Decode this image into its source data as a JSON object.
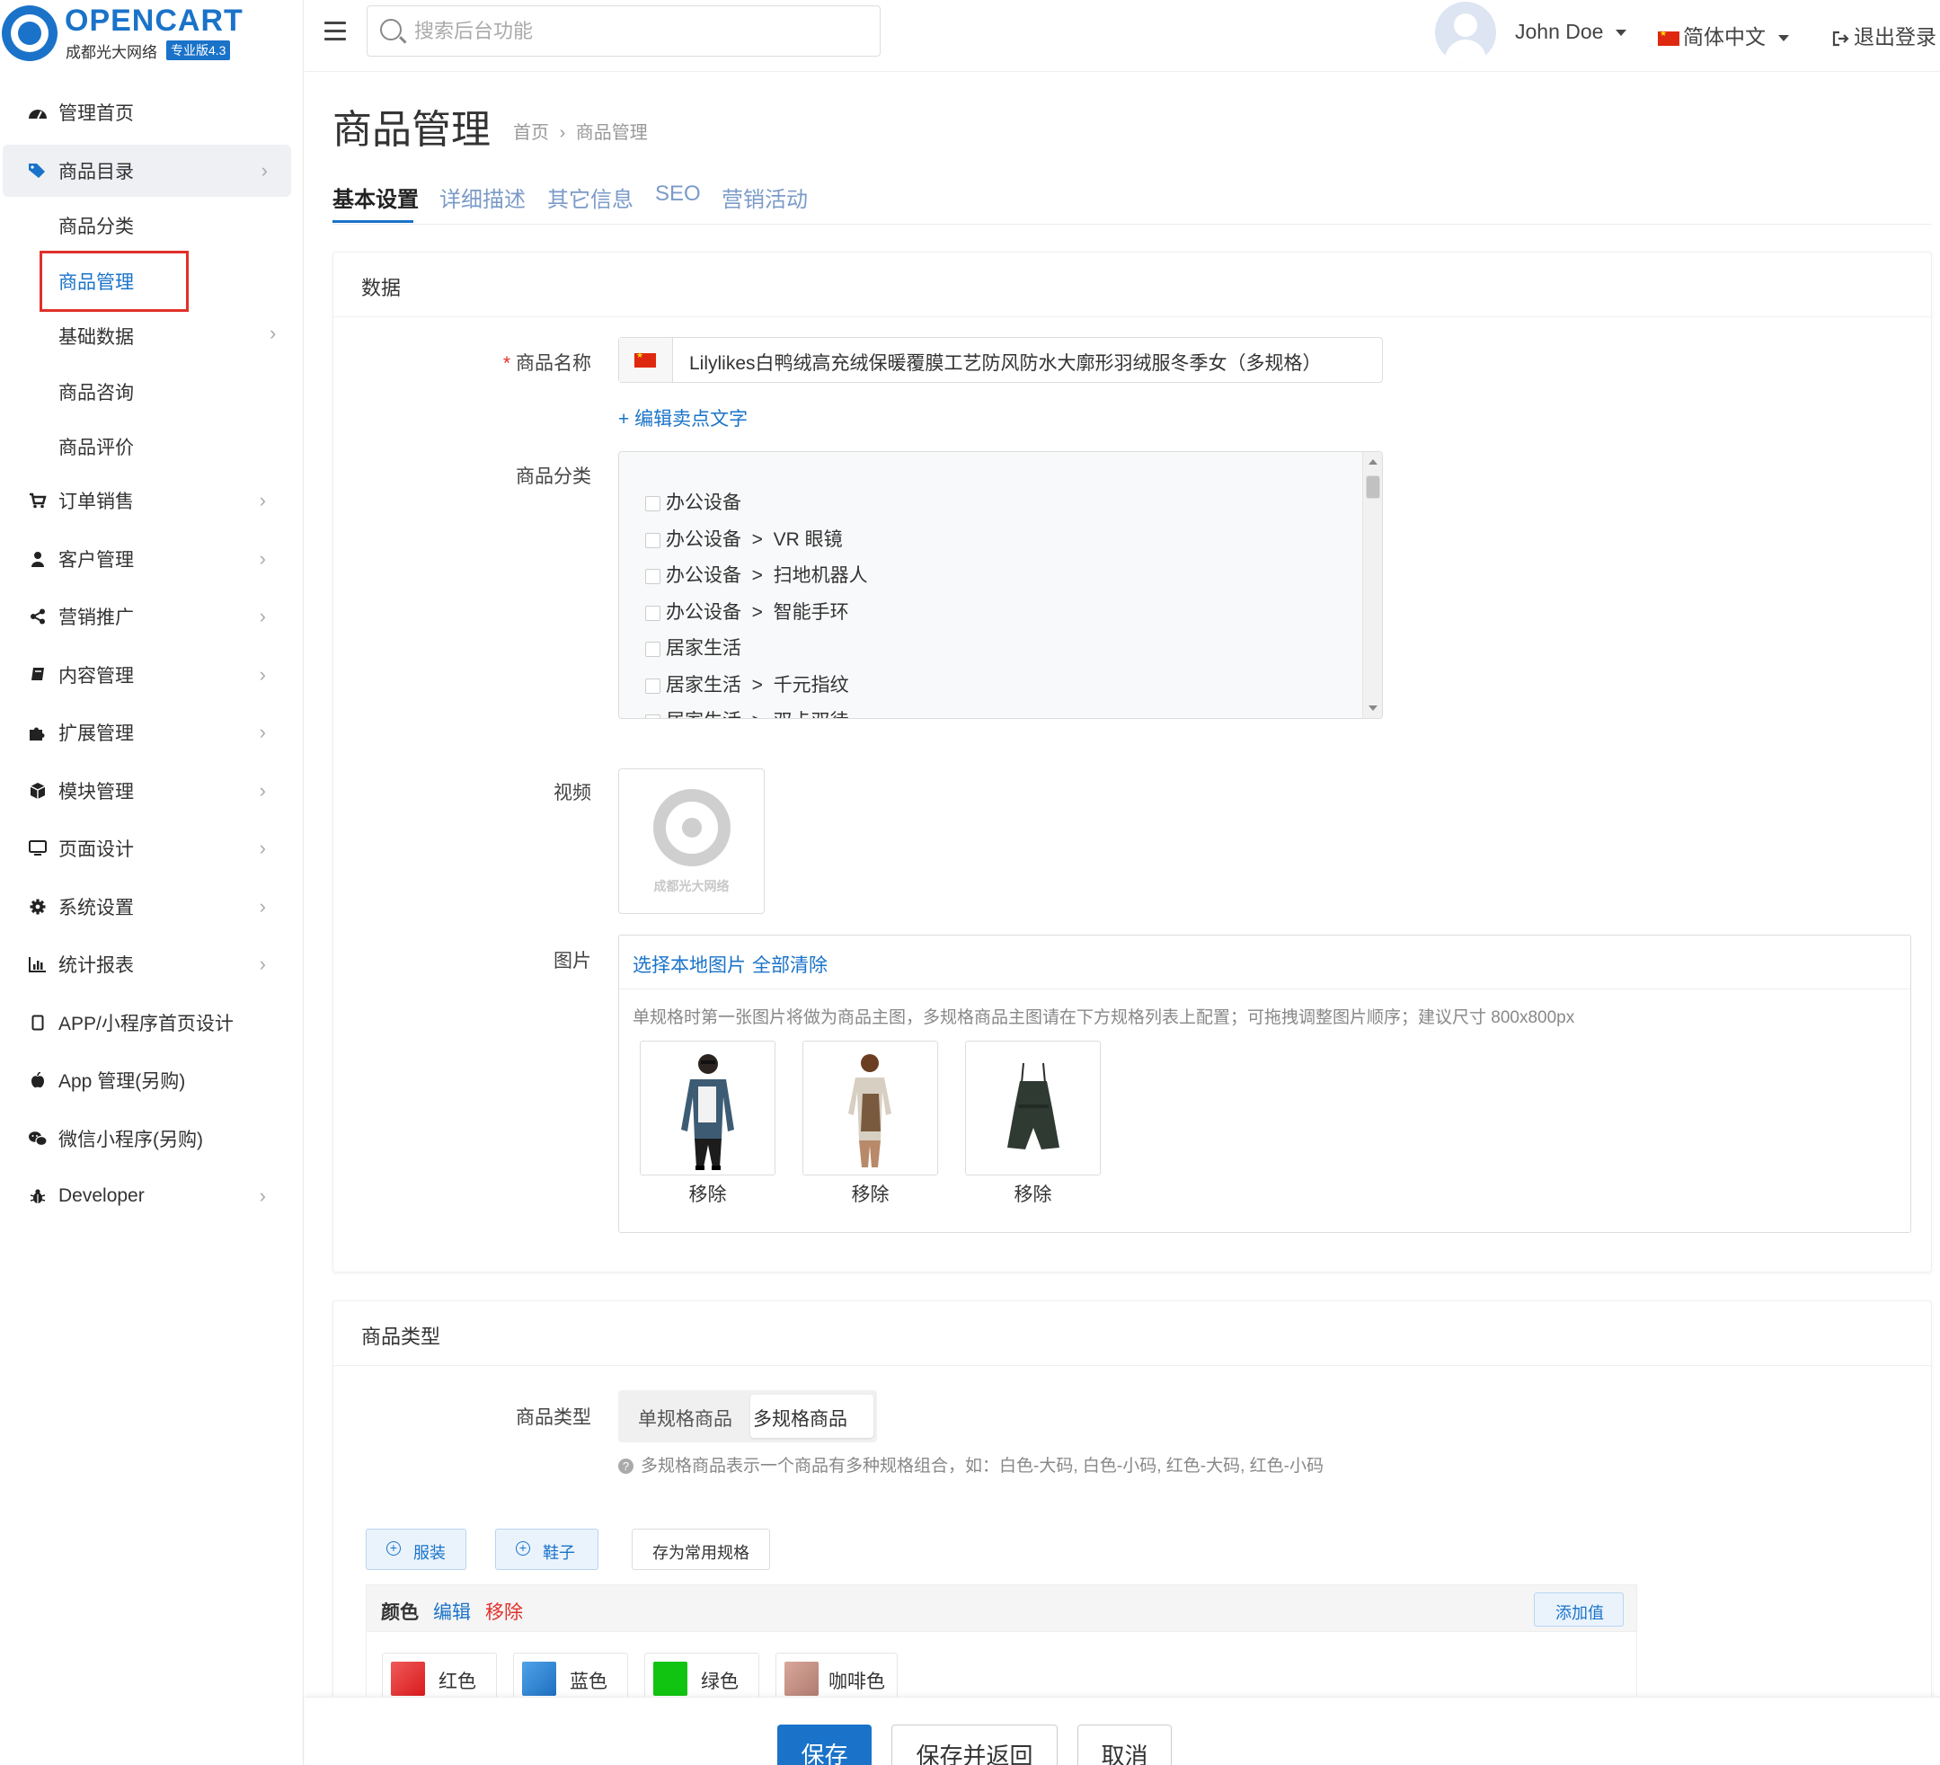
{
  "logo": {
    "title": "OPENCART",
    "subtitle": "成都光大网络",
    "badge": "专业版4.3"
  },
  "header": {
    "search_placeholder": "搜索后台功能",
    "username": "John Doe",
    "language": "简体中文",
    "logout": "退出登录"
  },
  "sidebar": {
    "items": [
      {
        "label": "管理首页",
        "icon": "dashboard-icon"
      },
      {
        "label": "商品目录",
        "icon": "tags-icon"
      },
      {
        "label": "订单销售",
        "icon": "cart-icon"
      },
      {
        "label": "客户管理",
        "icon": "user-icon"
      },
      {
        "label": "营销推广",
        "icon": "share-icon"
      },
      {
        "label": "内容管理",
        "icon": "book-icon"
      },
      {
        "label": "扩展管理",
        "icon": "puzzle-icon"
      },
      {
        "label": "模块管理",
        "icon": "cube-icon"
      },
      {
        "label": "页面设计",
        "icon": "desktop-icon"
      },
      {
        "label": "系统设置",
        "icon": "gear-icon"
      },
      {
        "label": "统计报表",
        "icon": "bar-chart-icon"
      },
      {
        "label": "APP/小程序首页设计",
        "icon": "mobile-icon"
      },
      {
        "label": "App 管理(另购)",
        "icon": "apple-icon"
      },
      {
        "label": "微信小程序(另购)",
        "icon": "wechat-icon"
      },
      {
        "label": "Developer",
        "icon": "bug-icon"
      }
    ],
    "sub_items": [
      {
        "label": "商品分类"
      },
      {
        "label": "商品管理"
      },
      {
        "label": "基础数据"
      },
      {
        "label": "商品咨询"
      },
      {
        "label": "商品评价"
      }
    ]
  },
  "page": {
    "title": "商品管理",
    "breadcrumb": {
      "home": "首页",
      "sep": "›",
      "current": "商品管理"
    },
    "tabs": [
      "基本设置",
      "详细描述",
      "其它信息",
      "SEO",
      "营销活动"
    ]
  },
  "data_card": {
    "title": "数据",
    "name_label": "商品名称",
    "required_mark": "*",
    "name_value": "Lilylikes白鸭绒高充绒保暖覆膜工艺防风防水大廓形羽绒服冬季女（多规格）",
    "edit_selling_text": "+ 编辑卖点文字",
    "category_label": "商品分类",
    "categories": [
      "办公设备",
      "办公设备  >  VR 眼镜",
      "办公设备  >  扫地机器人",
      "办公设备  >  智能手环",
      "居家生活",
      "居家生活  >  千元指纹",
      "居家生活  >  双卡双待"
    ],
    "video_label": "视频",
    "video_watermark": "成都光大网络",
    "image_label": "图片",
    "select_local_image": "选择本地图片",
    "clear_all": "全部清除",
    "image_hint": "单规格时第一张图片将做为商品主图，多规格商品主图请在下方规格列表上配置；可拖拽调整图片顺序；建议尺寸 800x800px",
    "remove_label": "移除"
  },
  "type_card": {
    "title": "商品类型",
    "type_label": "商品类型",
    "options": [
      "单规格商品",
      "多规格商品"
    ],
    "selected": "多规格商品",
    "hint": "多规格商品表示一个商品有多种规格组合，如：白色-大码, 白色-小码, 红色-大码, 红色-小码",
    "spec_buttons": [
      "服装",
      "鞋子"
    ],
    "save_common": "存为常用规格",
    "spec_group": {
      "name": "颜色",
      "edit": "编辑",
      "remove": "移除",
      "add_value": "添加值",
      "values": [
        {
          "label": "红色",
          "color": "#e8282b"
        },
        {
          "label": "蓝色",
          "color": "#2b86d6"
        },
        {
          "label": "绿色",
          "color": "#19c319"
        },
        {
          "label": "咖啡色",
          "color": "#c58a7e"
        }
      ]
    }
  },
  "footer": {
    "save": "保存",
    "save_return": "保存并返回",
    "cancel": "取消"
  },
  "colors": {
    "accent": "#1a73c9",
    "danger": "#e0302a"
  }
}
